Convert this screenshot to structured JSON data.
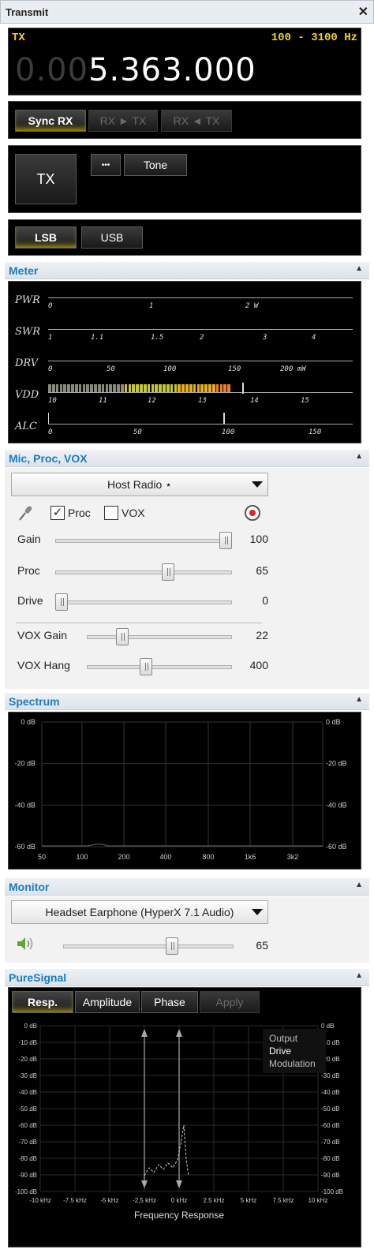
{
  "window": {
    "title": "Transmit",
    "close": "✕"
  },
  "vfo": {
    "label": "TX",
    "filter": "100 - 3100 Hz",
    "freq_dim": "0.00",
    "freq_bright": "5.363.000"
  },
  "buttons": {
    "sync_rx": "Sync RX",
    "rx_to_tx": "RX ► TX",
    "rx_from_tx": "RX ◄ TX",
    "tx": "TX",
    "more": "•••",
    "tone": "Tone",
    "lsb": "LSB",
    "usb": "USB"
  },
  "meter": {
    "section": "Meter",
    "rows": [
      {
        "label": "PWR",
        "ticks": [
          "0",
          "1",
          "2 W"
        ]
      },
      {
        "label": "SWR",
        "ticks": [
          "1",
          "1.1",
          "1.5",
          "2",
          "3",
          "4"
        ]
      },
      {
        "label": "DRV",
        "ticks": [
          "0",
          "50",
          "100",
          "150",
          "200 mW"
        ]
      },
      {
        "label": "VDD",
        "ticks": [
          "10",
          "11",
          "12",
          "13",
          "14",
          "15"
        ]
      },
      {
        "label": "ALC",
        "ticks": [
          "0",
          "50",
          "100",
          "150"
        ]
      }
    ],
    "vdd_level": 13.6
  },
  "mic": {
    "section": "Mic, Proc, VOX",
    "source": "Host Radio ⋆",
    "proc_label": "Proc",
    "proc_checked": true,
    "vox_label": "VOX",
    "vox_checked": false,
    "sliders": [
      {
        "label": "Gain",
        "value": "100",
        "fraction": 1.0
      },
      {
        "label": "Proc",
        "value": "65",
        "fraction": 0.65
      },
      {
        "label": "Drive",
        "value": "0",
        "fraction": 0.0
      },
      {
        "label": "VOX Gain",
        "value": "22",
        "fraction": 0.22
      },
      {
        "label": "VOX Hang",
        "value": "400",
        "fraction": 0.4
      }
    ]
  },
  "spectrum": {
    "section": "Spectrum",
    "y_labels": [
      "0 dB",
      "-20 dB",
      "-40 dB",
      "-60 dB"
    ],
    "x_labels": [
      "50",
      "100",
      "200",
      "400",
      "800",
      "1k6",
      "3k2"
    ]
  },
  "monitor": {
    "section": "Monitor",
    "device": "Headset Earphone (HyperX 7.1 Audio)",
    "volume": "65",
    "volume_fraction": 0.65
  },
  "puresignal": {
    "section": "PureSignal",
    "tabs": [
      "Resp.",
      "Amplitude",
      "Phase",
      "Apply"
    ],
    "legend": [
      "Output",
      "Drive",
      "Modulation"
    ],
    "y_labels": [
      "0 dB",
      "-10 dB",
      "-20 dB",
      "-30 dB",
      "-40 dB",
      "-50 dB",
      "-60 dB",
      "-70 dB",
      "-80 dB",
      "-90 dB",
      "-100 dB"
    ],
    "x_labels": [
      "-10 kHz",
      "-7.5 kHz",
      "-5 kHz",
      "-2.5 kHz",
      "0 kHz",
      "2.5 kHz",
      "5 kHz",
      "7.5 kHz",
      "10 kHz"
    ],
    "xlabel": "Frequency Response"
  }
}
